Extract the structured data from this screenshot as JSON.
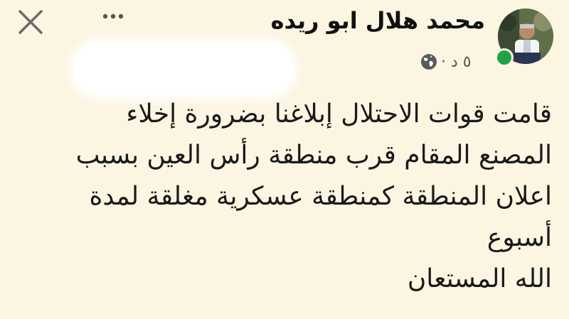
{
  "post": {
    "author": "محمد هلال ابو ريده",
    "time": "٥ د ·",
    "lines": [
      "قامت قوات الاحتلال إبلاغنا بضرورة إخلاء",
      "المصنع المقام قرب منطقة رأس العين بسبب",
      "اعلان المنطقة كمنطقة عسكرية مغلقة لمدة",
      "أسبوع",
      "الله المستعان"
    ]
  },
  "icons": {
    "close": "close-icon",
    "more": "more-icon",
    "privacy": "globe-icon"
  },
  "colors": {
    "background": "#fbf5e2",
    "online": "#1ea446",
    "text": "#1a1a1a"
  }
}
